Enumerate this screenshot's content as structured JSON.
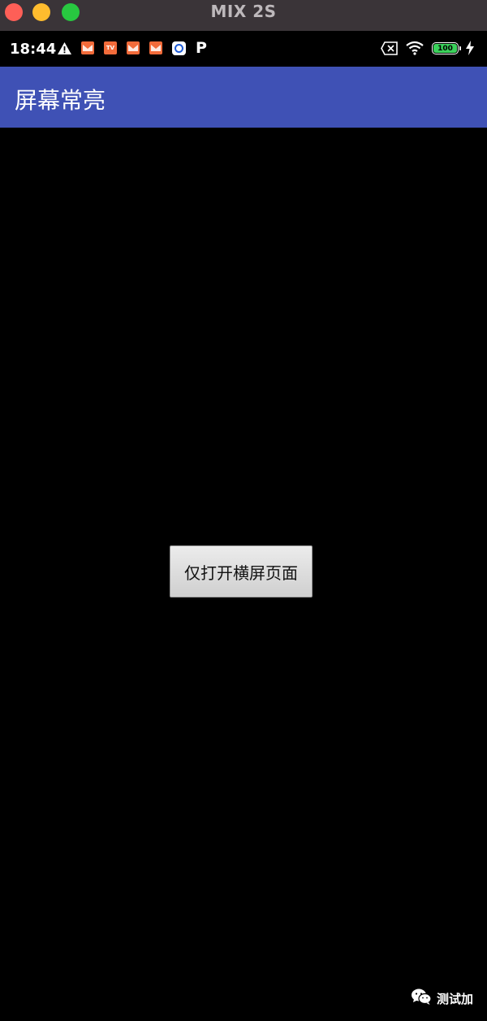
{
  "window": {
    "title": "MIX 2S"
  },
  "statusbar": {
    "time": "18:44",
    "notif_label": "TV",
    "app_letter": "P",
    "battery": "100"
  },
  "appbar": {
    "title": "屏幕常亮"
  },
  "main": {
    "button_label": "仅打开横屏页面"
  },
  "watermark": {
    "text": "测试加"
  },
  "colors": {
    "appbar": "#3f51b5",
    "background": "#000000",
    "battery": "#3ad15a",
    "notification": "#f26b3a"
  }
}
